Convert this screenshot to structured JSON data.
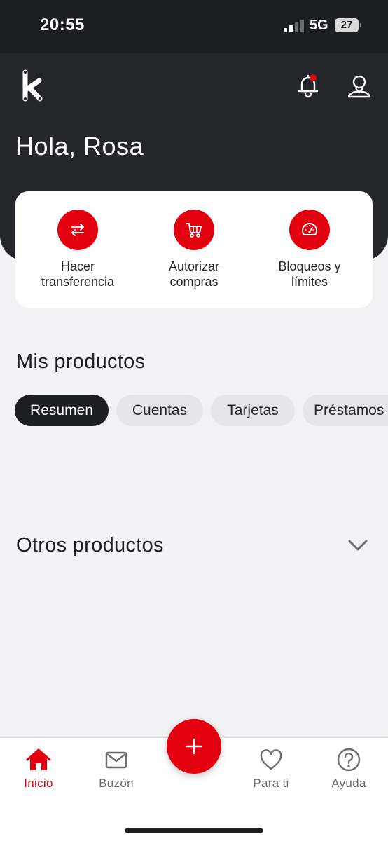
{
  "status_bar": {
    "time": "20:55",
    "network": "5G",
    "battery": "27"
  },
  "header": {
    "logo_icon": "k-logo",
    "greeting": "Hola, Rosa",
    "notification_icon": "bell-icon",
    "profile_icon": "user-icon",
    "has_notification_dot": true
  },
  "quick_actions": [
    {
      "label": "Hacer\ntransferencia",
      "icon": "transfer-arrows-icon"
    },
    {
      "label": "Autorizar\ncompras",
      "icon": "cart-icon"
    },
    {
      "label": "Bloqueos y\nlímites",
      "icon": "speedometer-icon"
    }
  ],
  "sections": {
    "mis_productos": "Mis productos",
    "otros_productos": "Otros productos"
  },
  "product_tabs": [
    {
      "label": "Resumen",
      "active": true
    },
    {
      "label": "Cuentas",
      "active": false
    },
    {
      "label": "Tarjetas",
      "active": false
    },
    {
      "label": "Préstamos",
      "active": false
    }
  ],
  "bottom_nav": {
    "items": [
      {
        "label": "Inicio",
        "icon": "home-icon",
        "active": true
      },
      {
        "label": "Buzón",
        "icon": "mail-icon",
        "active": false
      },
      {
        "label": "Para ti",
        "icon": "heart-icon",
        "active": false
      },
      {
        "label": "Ayuda",
        "icon": "help-icon",
        "active": false
      }
    ],
    "fab_icon": "plus-icon"
  },
  "colors": {
    "brand_red": "#e3000f",
    "header_dark": "#25262a",
    "background": "#f2f2f4"
  }
}
